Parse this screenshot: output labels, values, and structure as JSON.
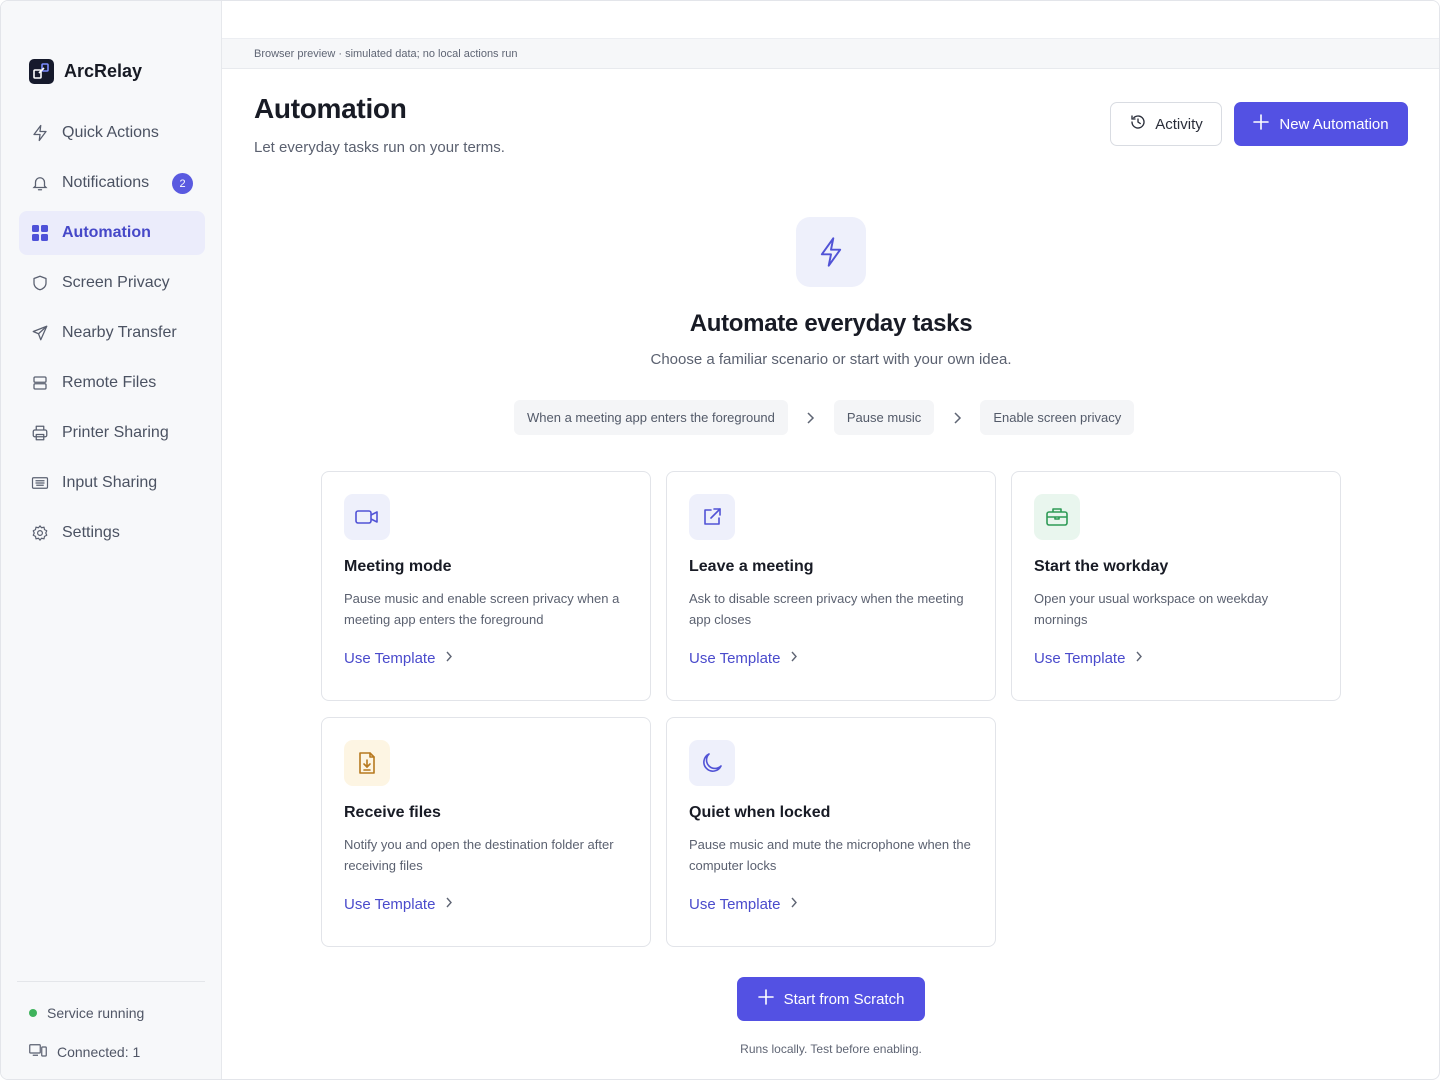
{
  "app": {
    "name": "ArcRelay"
  },
  "sidebar": {
    "items": [
      {
        "label": "Quick Actions",
        "icon": "lightning-icon"
      },
      {
        "label": "Notifications",
        "icon": "bell-icon",
        "badge": "2"
      },
      {
        "label": "Automation",
        "icon": "grid-icon",
        "active": true
      },
      {
        "label": "Screen Privacy",
        "icon": "shield-icon"
      },
      {
        "label": "Nearby Transfer",
        "icon": "send-icon"
      },
      {
        "label": "Remote Files",
        "icon": "server-icon"
      },
      {
        "label": "Printer Sharing",
        "icon": "printer-icon"
      },
      {
        "label": "Input Sharing",
        "icon": "keyboard-icon"
      },
      {
        "label": "Settings",
        "icon": "gear-icon"
      }
    ],
    "status": {
      "service": "Service running",
      "connected": "Connected: 1"
    }
  },
  "preview_notice": "Browser preview · simulated data; no local actions run",
  "header": {
    "title": "Automation",
    "subtitle": "Let everyday tasks run on your terms.",
    "activity_label": "Activity",
    "new_label": "New Automation"
  },
  "hero": {
    "title": "Automate everyday tasks",
    "subtitle": "Choose a familiar scenario or start with your own idea.",
    "flow": [
      "When a meeting app enters the foreground",
      "Pause music",
      "Enable screen privacy"
    ]
  },
  "templates": [
    {
      "title": "Meeting mode",
      "desc": "Pause music and enable screen privacy when a meeting app enters the foreground",
      "link": "Use Template",
      "icon": "video-icon",
      "accent": "#eef0fb"
    },
    {
      "title": "Leave a meeting",
      "desc": "Ask to disable screen privacy when the meeting app closes",
      "link": "Use Template",
      "icon": "external-link-icon",
      "accent": "#eef0fb"
    },
    {
      "title": "Start the workday",
      "desc": "Open your usual workspace on weekday mornings",
      "link": "Use Template",
      "icon": "briefcase-icon",
      "accent": "#e9f6ee"
    },
    {
      "title": "Receive files",
      "desc": "Notify you and open the destination folder after receiving files",
      "link": "Use Template",
      "icon": "file-download-icon",
      "accent": "#fdf5e3"
    },
    {
      "title": "Quiet when locked",
      "desc": "Pause music and mute the microphone when the computer locks",
      "link": "Use Template",
      "icon": "moon-icon",
      "accent": "#eef0fb"
    }
  ],
  "scratch_label": "Start from Scratch",
  "footnote": "Runs locally. Test before enabling.",
  "colors": {
    "accent": "#5351e3",
    "status_ok": "#3fb35c"
  }
}
